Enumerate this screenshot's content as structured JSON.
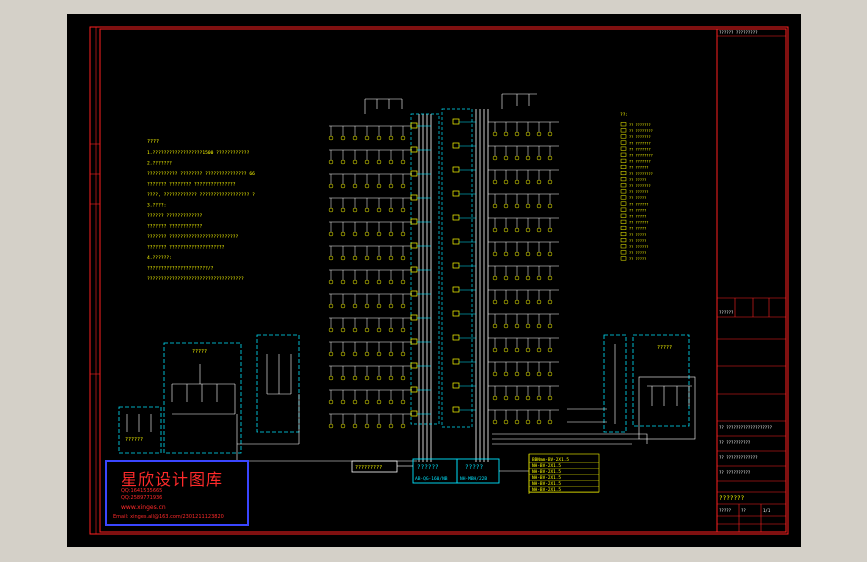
{
  "colors": {
    "frame": "#ff2020",
    "wire": "#ffffff",
    "device": "#ffff00",
    "panel": "#00e5ff",
    "canvas": "#000000",
    "window": "#d4d0c8",
    "stamp_border": "#3a46ff"
  },
  "notes": {
    "heading": "????",
    "lines": [
      "1.??????????????????1500   ????????????",
      "2.???????",
      "  ??????????? ????????     ??????????????? 66",
      "  ??????? ????????       ???????????????",
      "  ????, ????????????     ?????????????????? ?",
      "3.????:",
      "  ??????   ?????????????",
      "  ???????  ????????????",
      "  ???????  ?????????????????????????",
      "  ???????  ????????????????????",
      "4.??????:",
      "  ??????????????????????/?",
      "  ???????????????????????????????????"
    ]
  },
  "legend": {
    "heading": "??:",
    "rows": [
      "?? ???????",
      "?? ????????",
      "?? ???????",
      "?? ???????",
      "?? ???????",
      "?? ????????",
      "?? ???????",
      "?? ??????",
      "?? ????????",
      "?? ?????",
      "?? ???????",
      "?? ??????",
      "?? ?????",
      "?? ??????",
      "?? ?????",
      "?? ?????",
      "?? ??????",
      "?? ?????",
      "?? ?????",
      "?? ?????",
      "?? ??????",
      "?? ?????",
      "?? ?????"
    ]
  },
  "panels": {
    "left_upper": "?????",
    "left_lower": "??????",
    "right": "?????",
    "meter": "?????????",
    "main_box_left": "??????",
    "main_box_left_code": "AB-QG-160/NB",
    "main_box_right": "?????",
    "main_box_right_code": "NH-MBH/22B"
  },
  "cable_notes": [
    "BBNmm-BV-2X1.5",
    "NH-BV-2X1.5",
    "NH-BV-2X1.5",
    "NH-BV-2X1.5",
    "NH-BV-2X1.5",
    "NH-BV-2X1.5"
  ],
  "title_block": {
    "top": "?????? ?????????",
    "stamp_header": "??????",
    "project_rows": [
      "?? ???????????????????",
      "?? ??????????",
      "?? ?????????????",
      "?? ??????????"
    ],
    "drawing_name": "???????",
    "drawing_no": "?????",
    "sheet": "1/1",
    "scale": "??"
  },
  "stamp": {
    "name": "星欣设计图库",
    "qq1": "QQ:1641535665",
    "qq2": "QQ:2589771936",
    "website": "www.xinges.cn",
    "email": "Email: xinges.all@163.com/2301211123820"
  }
}
